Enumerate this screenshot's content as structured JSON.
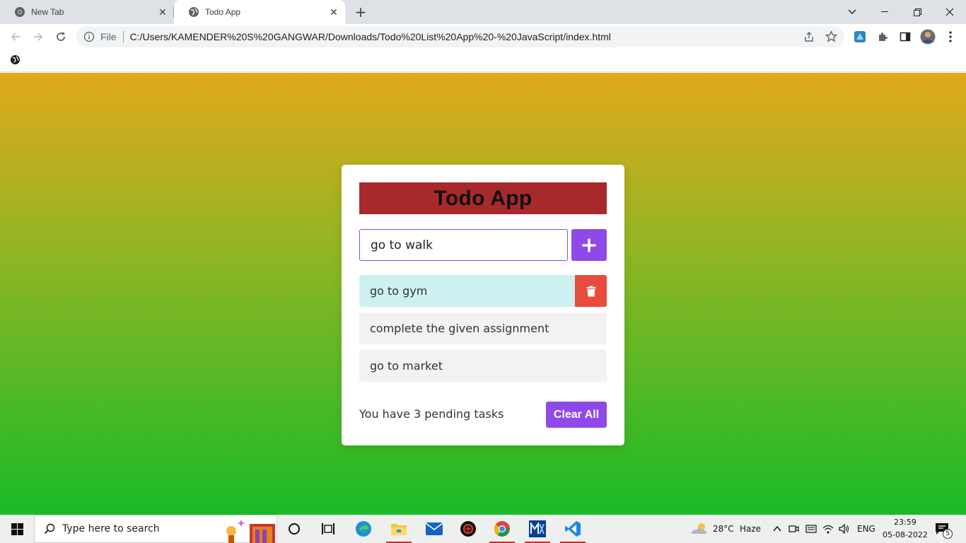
{
  "browser": {
    "tabs": [
      {
        "title": "New Tab",
        "active": false
      },
      {
        "title": "Todo App",
        "active": true
      }
    ],
    "omnibox": {
      "scheme_label": "File",
      "url": "C:/Users/KAMENDER%20S%20GANGWAR/Downloads/Todo%20List%20App%20-%20JavaScript/index.html"
    }
  },
  "app": {
    "title": "Todo App",
    "input_value": "go to walk",
    "tasks": [
      {
        "text": "go to gym",
        "hovered": true
      },
      {
        "text": "complete the given assignment",
        "hovered": false
      },
      {
        "text": "go to market",
        "hovered": false
      }
    ],
    "pending_text": "You have 3 pending tasks",
    "clear_label": "Clear All"
  },
  "taskbar": {
    "search_placeholder": "Type here to search",
    "weather_temp": "28°C",
    "weather_desc": "Haze",
    "language": "ENG",
    "time": "23:59",
    "date": "05-08-2022",
    "notification_count": "5"
  },
  "colors": {
    "accent_purple": "#8e49e8",
    "title_bar_red": "#a8292b",
    "delete_red": "#e74c3c",
    "hover_item": "#cdf0f1",
    "gradient_top": "#e1aa1d",
    "gradient_bottom": "#19bb27"
  }
}
